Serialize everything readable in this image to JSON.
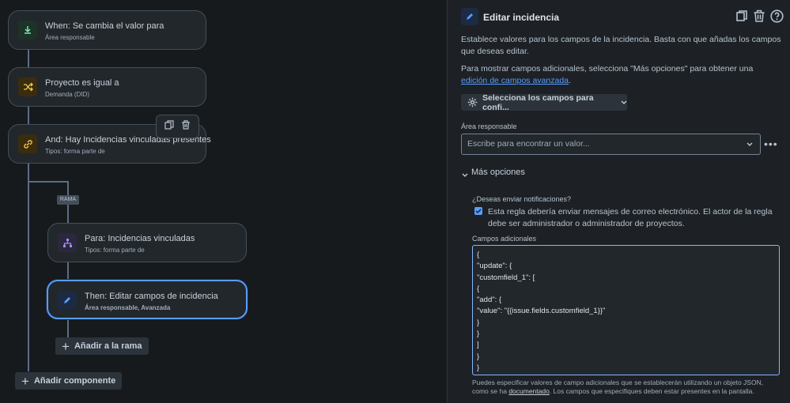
{
  "canvas": {
    "cards": [
      {
        "title": "When: Se cambia el valor para",
        "subtitle": "Área responsable",
        "icon": "trigger-icon"
      },
      {
        "title": "Proyecto es igual a",
        "subtitle": "Demanda (DID)",
        "icon": "shuffle-icon"
      },
      {
        "title": "And: Hay Incidencias vinculadas presentes",
        "subtitle": "Tipos: forma parte de",
        "icon": "link-icon"
      },
      {
        "title": "Para: Incidencias vinculadas",
        "subtitle": "Tipos: forma parte de",
        "icon": "branch-icon"
      },
      {
        "title": "Then: Editar campos de incidencia",
        "subtitle": "Área responsable, Avanzada",
        "icon": "pencil-icon"
      }
    ],
    "branch_label": "RAMA",
    "add_to_branch": "Añadir a la rama",
    "add_component": "Añadir componente"
  },
  "panel": {
    "title": "Editar incidencia",
    "intro": "Establece valores para los campos de la incidencia. Basta con que añadas los campos que deseas editar.",
    "more_info_prefix": "Para mostrar campos adicionales, selecciona \"Más opciones\" para obtener una ",
    "more_info_link": "edición de campos avanzada",
    "more_info_suffix": ".",
    "select_fields_button": "Selecciona los campos para confi...",
    "field_label": "Área responsable",
    "field_placeholder": "Escribe para encontrar un valor...",
    "more_options": "Más opciones",
    "notify_question": "¿Deseas enviar notificaciones?",
    "notify_checkbox": "Esta regla debería enviar mensajes de correo electrónico. El actor de la regla debe ser administrador o administrador de proyectos.",
    "notify_checked": true,
    "additional_label": "Campos adicionales",
    "json_text": "{\n\"update\": {\n\"customfield_1\": [\n{\n\"add\": {\n\"value\": \"{{issue.fields.customfield_1}}\"\n}\n}\n]\n}\n}",
    "help_prefix": "Puedes especificar valores de campo adicionales que se establecerán utilizando un objeto JSON, como se ha ",
    "help_link": "documentado",
    "help_suffix": ". Los campos que especifiques deben estar presentes en la pantalla."
  },
  "colors": {
    "accent": "#579dff",
    "background": "#1d2125",
    "canvas": "#161a1d"
  }
}
